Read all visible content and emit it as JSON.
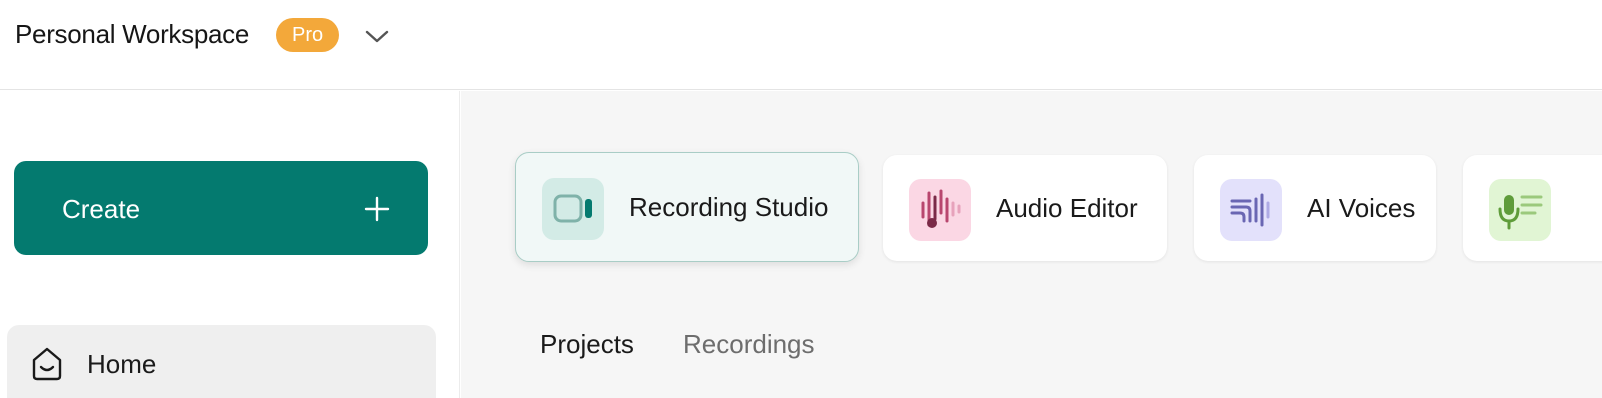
{
  "workspace": {
    "title": "Personal Workspace",
    "badge": "Pro"
  },
  "sidebar": {
    "create_label": "Create",
    "items": [
      {
        "label": "Home",
        "icon": "home-icon"
      }
    ]
  },
  "tools": [
    {
      "label": "Recording Studio",
      "icon": "video-camera-icon",
      "active": true
    },
    {
      "label": "Audio Editor",
      "icon": "audio-waveform-note-icon",
      "active": false
    },
    {
      "label": "AI Voices",
      "icon": "ai-voice-waveform-icon",
      "active": false
    },
    {
      "label": "",
      "icon": "microphone-transcript-icon",
      "active": false
    }
  ],
  "tabs": [
    {
      "label": "Projects",
      "selected": true
    },
    {
      "label": "Recordings",
      "selected": false
    }
  ],
  "colors": {
    "brand": "#047a6f",
    "badge": "#f3a83a",
    "recording_icon_bg": "#d3ebe6",
    "audio_icon_bg": "#fbd7e4",
    "voices_icon_bg": "#e3e1fb",
    "mic_icon_bg": "#e1f5d4"
  }
}
